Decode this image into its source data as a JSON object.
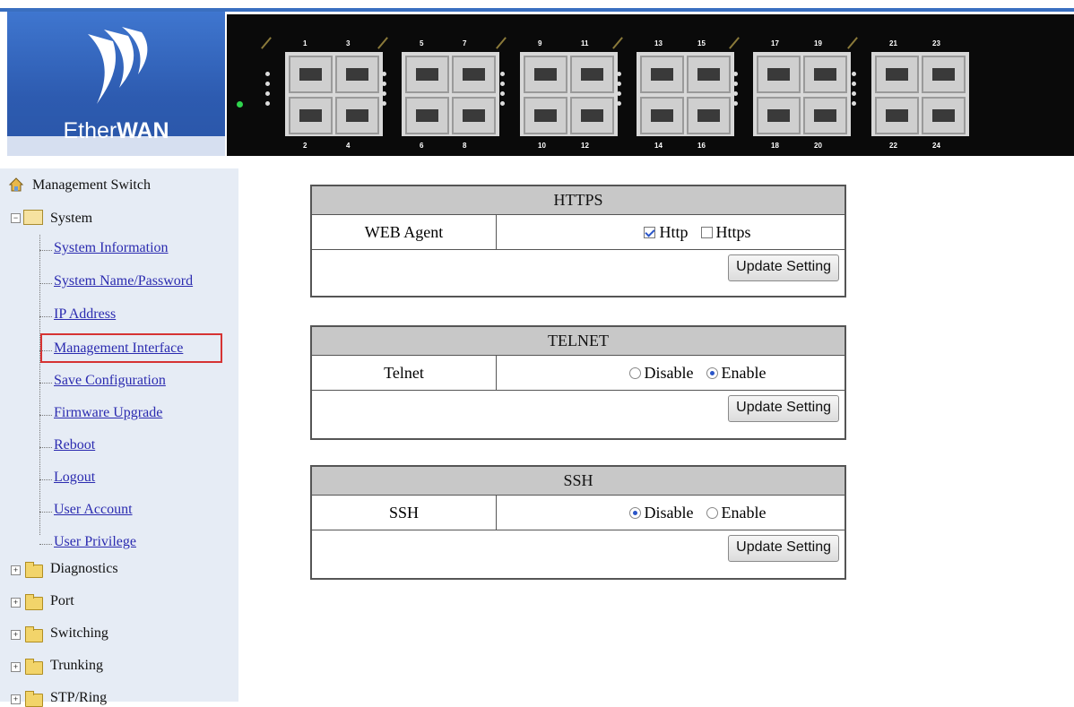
{
  "header": {
    "brand_prefix": "Ether",
    "brand_suffix": "WAN",
    "ports_top": [
      "1",
      "3",
      "5",
      "7",
      "9",
      "11",
      "13",
      "15",
      "17",
      "19",
      "21",
      "23"
    ],
    "ports_bottom": [
      "2",
      "4",
      "6",
      "8",
      "10",
      "12",
      "14",
      "16",
      "18",
      "20",
      "22",
      "24"
    ]
  },
  "sidebar": {
    "root": "Management Switch",
    "system": "System",
    "items": [
      "System Information",
      "System Name/Password",
      "IP Address",
      "Management Interface",
      "Save Configuration",
      "Firmware Upgrade",
      "Reboot",
      "Logout",
      "User Account",
      "User Privilege"
    ],
    "folders": [
      "Diagnostics",
      "Port",
      "Switching",
      "Trunking",
      "STP/Ring"
    ]
  },
  "https": {
    "title": "HTTPS",
    "label": "WEB Agent",
    "opt1": "Http",
    "opt1_checked": true,
    "opt2": "Https",
    "opt2_checked": false,
    "button": "Update Setting"
  },
  "telnet": {
    "title": "TELNET",
    "label": "Telnet",
    "opt1": "Disable",
    "opt2": "Enable",
    "selected": "Enable",
    "button": "Update Setting"
  },
  "ssh": {
    "title": "SSH",
    "label": "SSH",
    "opt1": "Disable",
    "opt2": "Enable",
    "selected": "Disable",
    "button": "Update Setting"
  },
  "colors": {
    "logo_blue": "#2d5bb0",
    "sidebar_bg": "#e6ecf5",
    "highlight": "#d63333",
    "link": "#2b2bb0"
  }
}
